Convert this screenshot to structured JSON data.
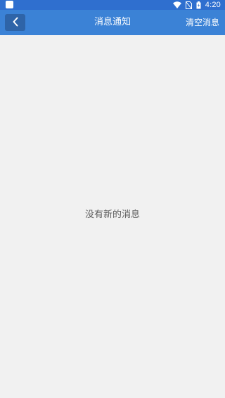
{
  "status_bar": {
    "time": "4:20",
    "icons": [
      "app-icon",
      "wifi-icon",
      "no-sim-icon",
      "battery-icon"
    ]
  },
  "header": {
    "title": "消息通知",
    "back_icon": "chevron-left-icon",
    "clear_label": "清空消息"
  },
  "main": {
    "empty_message": "没有新的消息"
  },
  "colors": {
    "status_bar": "#2f6fcf",
    "app_bar": "#3b82d6",
    "back_button": "#2e64a8",
    "background": "#f1f1f1",
    "empty_text": "#5d5d5d"
  }
}
